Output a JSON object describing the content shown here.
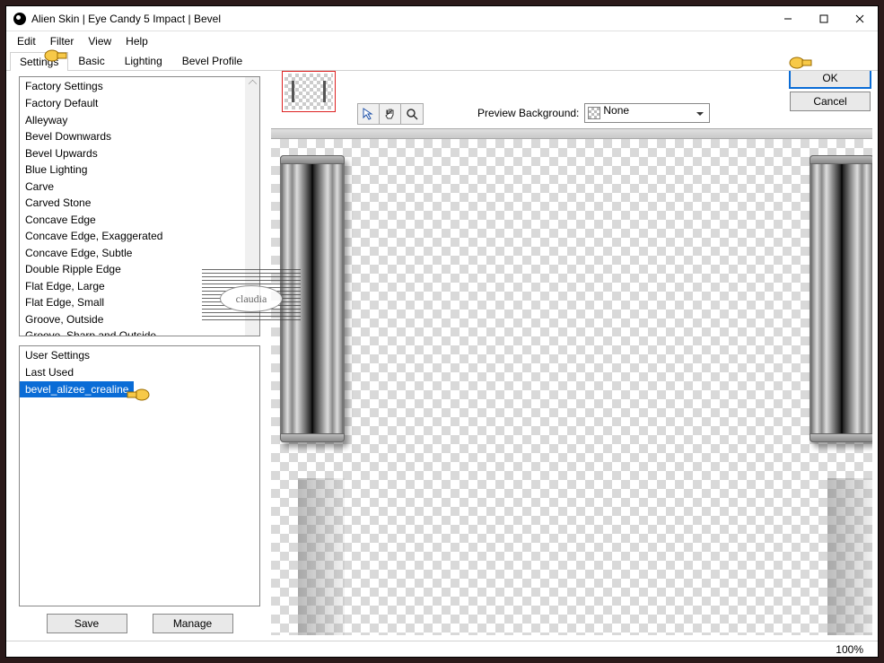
{
  "window": {
    "title": "Alien Skin | Eye Candy 5 Impact | Bevel"
  },
  "menubar": [
    "Edit",
    "Filter",
    "View",
    "Help"
  ],
  "tabs": {
    "items": [
      "Settings",
      "Basic",
      "Lighting",
      "Bevel Profile"
    ],
    "active": 0
  },
  "factory": {
    "header": "Factory Settings",
    "items": [
      "Factory Default",
      "Alleyway",
      "Bevel Downwards",
      "Bevel Upwards",
      "Blue Lighting",
      "Carve",
      "Carved Stone",
      "Concave Edge",
      "Concave Edge, Exaggerated",
      "Concave Edge, Subtle",
      "Double Ripple Edge",
      "Flat Edge, Large",
      "Flat Edge, Small",
      "Groove, Outside",
      "Groove, Sharp and Outside"
    ]
  },
  "user": {
    "header": "User Settings",
    "items": [
      "Last Used",
      "bevel_alizee_crealine"
    ],
    "selected_index": 1
  },
  "buttons": {
    "save": "Save",
    "manage": "Manage",
    "ok": "OK",
    "cancel": "Cancel"
  },
  "preview": {
    "bg_label": "Preview Background:",
    "bg_value": "None"
  },
  "status": {
    "zoom": "100%"
  },
  "watermark": "claudia"
}
